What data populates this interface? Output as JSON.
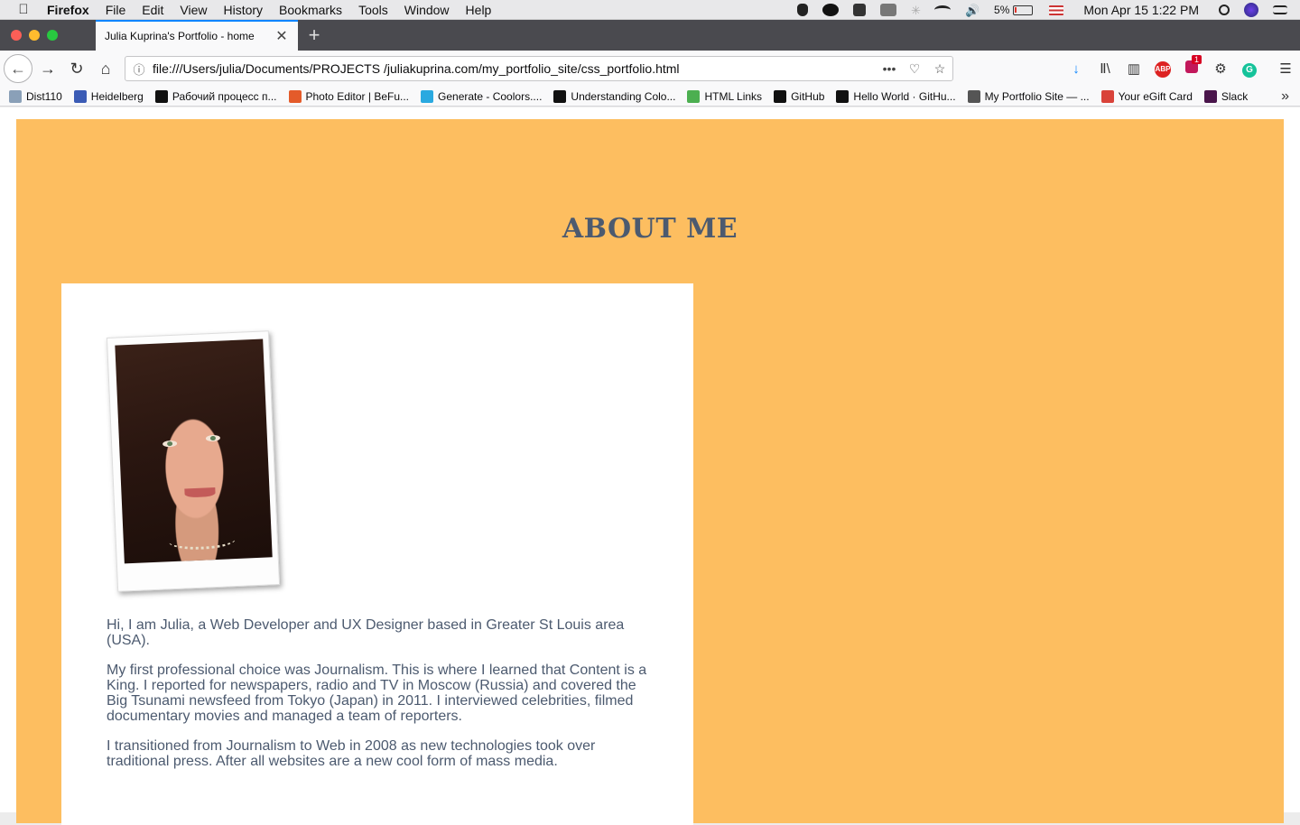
{
  "menubar": {
    "app": "Firefox",
    "items": [
      "File",
      "Edit",
      "View",
      "History",
      "Bookmarks",
      "Tools",
      "Window",
      "Help"
    ],
    "battery": "5%",
    "battery_level": 0.05,
    "clock": "Mon Apr 15  1:22 PM"
  },
  "tab": {
    "title": "Julia Kuprina's Portfolio - home"
  },
  "toolbar": {
    "url": "file:///Users/julia/Documents/PROJECTS /juliakuprina.com/my_portfolio_site/css_portfolio.html",
    "extension_badge": "1"
  },
  "bookmarks": [
    {
      "label": "Dist110",
      "icon": "bookmark-icon",
      "color": "#8aa0b8"
    },
    {
      "label": "Heidelberg",
      "icon": "calendar-icon",
      "color": "#3b5bb5"
    },
    {
      "label": "Рабочий процесс п...",
      "icon": "medium-icon",
      "color": "#111111"
    },
    {
      "label": "Photo Editor | BeFu...",
      "icon": "befunky-icon",
      "color": "#e45b2a"
    },
    {
      "label": "Generate - Coolors....",
      "icon": "coolors-icon",
      "color": "#2aa9e0"
    },
    {
      "label": "Understanding Colo...",
      "icon": "chart-icon",
      "color": "#111111"
    },
    {
      "label": "HTML Links",
      "icon": "w3schools-icon",
      "color": "#4caf50"
    },
    {
      "label": "GitHub",
      "icon": "github-icon",
      "color": "#111111"
    },
    {
      "label": "Hello World · GitHu...",
      "icon": "github-icon",
      "color": "#111111"
    },
    {
      "label": "My Portfolio Site — ...",
      "icon": "globe-icon",
      "color": "#555555"
    },
    {
      "label": "Your eGift Card",
      "icon": "gift-icon",
      "color": "#d9433a"
    },
    {
      "label": "Slack",
      "icon": "slack-icon",
      "color": "#4a154b"
    }
  ],
  "page": {
    "heading": "ABOUT ME",
    "background_color": "#fdbe60",
    "text_color": "#4c5a6f",
    "paragraphs": [
      "Hi, I am Julia, a Web Developer and UX Designer based in Greater St Louis area (USA).",
      "My first professional choice was Journalism. This is where I learned that Content is a King. I reported for newspapers, radio and TV in Moscow (Russia) and covered the Big Tsunami newsfeed from Tokyo (Japan) in 2011. I interviewed celebrities, filmed documentary movies and managed a team of reporters.",
      "I transitioned from Journalism to Web in 2008 as new technologies took over traditional press. After all websites are a new cool form of mass media."
    ]
  }
}
